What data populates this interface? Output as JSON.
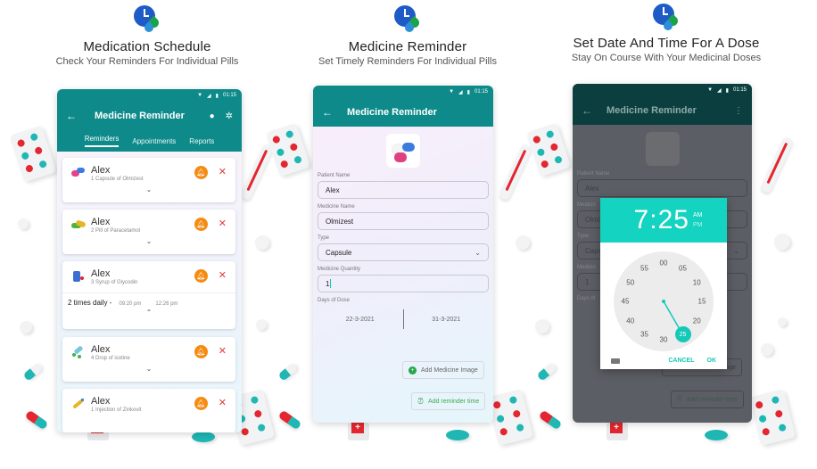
{
  "panels": [
    {
      "title": "Medication Schedule",
      "subtitle": "Check Your Reminders For Individual Pills"
    },
    {
      "title": "Medicine Reminder",
      "subtitle": "Set Timely Reminders For Individual Pills"
    },
    {
      "title": "Set Date And Time For A Dose",
      "subtitle": "Stay On Course With Your Medicinal Doses"
    }
  ],
  "status_bar": {
    "time": "01:15"
  },
  "app": {
    "title": "Medicine Reminder",
    "back_icon": "arrow-left-icon",
    "colors": {
      "primary": "#0e8a8a",
      "bell": "#f58b11",
      "delete": "#e23d3d",
      "accent": "#14d3c0"
    }
  },
  "reminders_screen": {
    "tabs": [
      {
        "label": "Reminders",
        "active": true
      },
      {
        "label": "Appointments",
        "active": false
      },
      {
        "label": "Reports",
        "active": false
      }
    ],
    "items": [
      {
        "name": "Alex",
        "desc": "1 Capsule of Olmizest",
        "icon": "capsule-icon",
        "expanded": false
      },
      {
        "name": "Alex",
        "desc": "2 Pill of Paracetamol",
        "icon": "pill-icon",
        "expanded": false
      },
      {
        "name": "Alex",
        "desc": "3 Syrup of Glycodin",
        "icon": "syrup-icon",
        "expanded": true,
        "frequency": "2 times daily -",
        "times": [
          "09:20 pm",
          "12:26 pm"
        ]
      },
      {
        "name": "Alex",
        "desc": "4 Drop of isotine",
        "icon": "drop-icon",
        "expanded": false
      },
      {
        "name": "Alex",
        "desc": "1 Injection of Zinkovit",
        "icon": "injection-icon",
        "expanded": false
      }
    ]
  },
  "form": {
    "patient_name_label": "Patient Name",
    "patient_name": "Alex",
    "medicine_name_label": "Medicine Name",
    "medicine_name": "Olmizest",
    "type_label": "Type",
    "type_value": "Capsule",
    "quantity_label": "Medicine Quantity",
    "quantity": "1",
    "days_label": "Days of Dose",
    "start_date": "22-3-2021",
    "end_date": "31-3-2021",
    "add_image_label": "Add Medicine Image",
    "add_time_label": "Add reminder time"
  },
  "time_picker": {
    "time": "7:25",
    "am": "AM",
    "pm": "PM",
    "selected_period": "AM",
    "selected_minute": "25",
    "minutes": [
      "00",
      "05",
      "10",
      "15",
      "20",
      "25",
      "30",
      "35",
      "40",
      "45",
      "50",
      "55"
    ],
    "cancel_label": "CANCEL",
    "ok_label": "OK",
    "dim_form": {
      "patient_name_label": "Patient Name",
      "patient_name": "Alex",
      "medicine_label_partial": "Medicin",
      "medicine_partial": "Olmi",
      "type_label": "Type",
      "type_partial": "Capsu",
      "quantity_label_partial": "Medicin",
      "quantity": "1",
      "days_label_partial": "Days of",
      "add_image_partial": "age",
      "add_time_label": "Add reminder time"
    }
  }
}
